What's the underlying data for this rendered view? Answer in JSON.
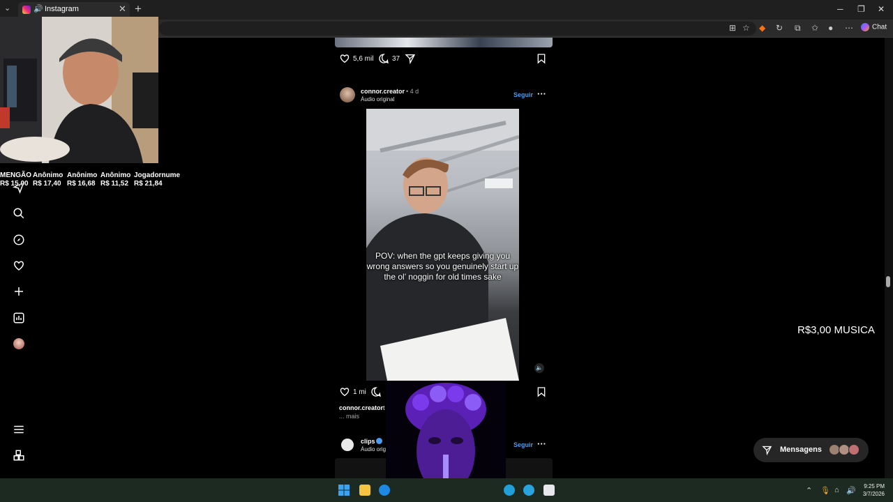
{
  "browser": {
    "tab_title": "Instagram",
    "chat_label": "Chat",
    "tab_menu_glyph": "⌄",
    "new_tab_glyph": "+",
    "close_glyph": "✕"
  },
  "donors": [
    {
      "name": "MENGÃO",
      "amount": "R$ 15,00"
    },
    {
      "name": "Anônimo",
      "amount": "R$ 17,40"
    },
    {
      "name": "Anônimo",
      "amount": "R$ 16,68"
    },
    {
      "name": "Anônimo",
      "amount": "R$ 11,52"
    },
    {
      "name": "Jogadornume",
      "amount": "R$ 21,84"
    }
  ],
  "nav": {
    "icons": [
      "messenger-icon",
      "search-icon",
      "explore-icon",
      "heart-icon",
      "create-icon",
      "dashboard-icon",
      "profile-icon",
      "menu-icon",
      "more-apps-icon"
    ]
  },
  "feed": {
    "post1": {
      "likes": "5,6 mil",
      "comments": "37"
    },
    "post2": {
      "username": "connor.creator",
      "age": "• 4 d",
      "audio": "Áudio original",
      "follow": "Seguir",
      "caption": "POV: when the gpt keeps giving you wrong answers so you genuinely start up the ol’ noggin for old times sake",
      "likes": "1 mi",
      "comments": "",
      "caption_user": "connor.creator",
      "caption_text": "t",
      "more": "... mais"
    },
    "post3": {
      "username": "clips",
      "audio": "Áudio origi",
      "follow": "Seguir"
    }
  },
  "overlay_text": "R$3,00 MUSICA",
  "messages": {
    "label": "Mensagens"
  },
  "clock": {
    "time": "9:25 PM",
    "date": "3/7/2026"
  },
  "colors": {
    "link": "#4a9df5",
    "background": "#000000"
  }
}
